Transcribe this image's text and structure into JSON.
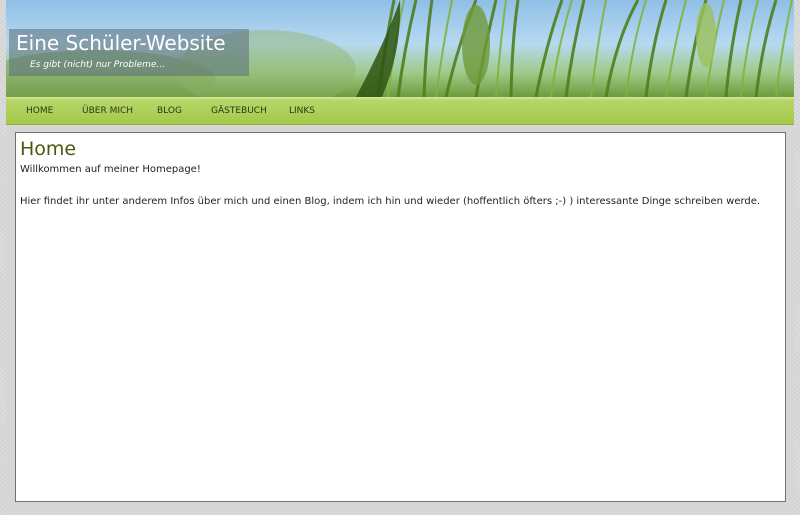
{
  "header": {
    "title": "Eine Schüler-Website",
    "subtitle": "Es gibt (nicht) nur Probleme..."
  },
  "nav": {
    "items": [
      "HOME",
      "ÜBER MICH",
      "BLOG",
      "GÄSTEBUCH",
      "LINKS"
    ]
  },
  "main": {
    "heading": "Home",
    "welcome": "Willkommen auf meiner Homepage!",
    "intro": "Hier findet ihr unter anderem Infos über mich und einen Blog, indem ich hin und wieder (hoffentlich öfters ;-) ) interessante Dinge schreiben werde."
  },
  "colors": {
    "nav_green": "#a3c94a",
    "heading_olive": "#4a5a12"
  }
}
